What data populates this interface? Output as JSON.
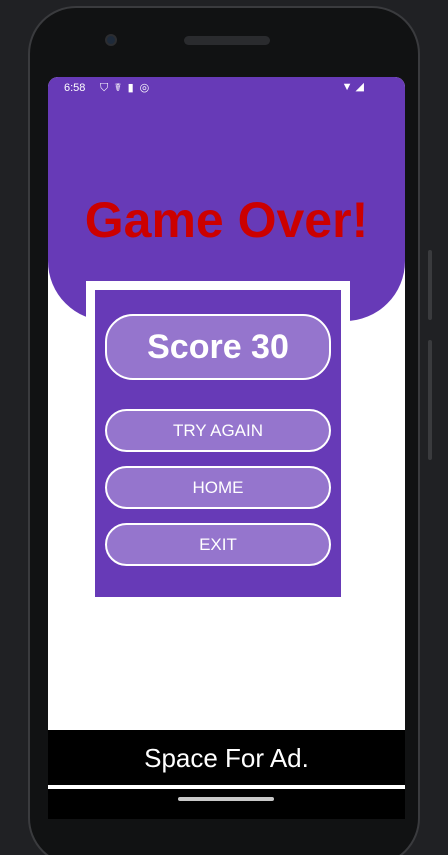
{
  "status_bar": {
    "time": "6:58",
    "left_icons": [
      "shield-icon",
      "bug-icon",
      "sd-card-icon",
      "sync-icon"
    ],
    "right_icons": [
      "wifi-icon",
      "signal-icon"
    ]
  },
  "header": {
    "title": "Game Over!",
    "title_color": "#cc0000",
    "background_color": "#673ab7"
  },
  "panel": {
    "score_label": "Score 30",
    "buttons": {
      "try_again": "TRY AGAIN",
      "home": "HOME",
      "exit": "EXIT"
    },
    "button_color": "#9575cd"
  },
  "ad": {
    "text": "Space For Ad."
  }
}
